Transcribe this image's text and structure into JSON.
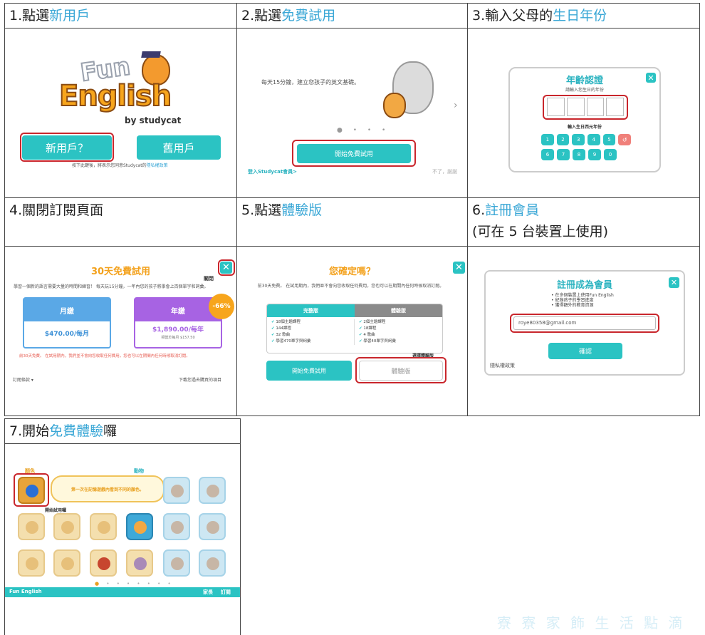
{
  "steps": [
    {
      "num": "1.",
      "pre": "點選",
      "hl": "新用戶",
      "post": "",
      "line2": ""
    },
    {
      "num": "2.",
      "pre": "點選",
      "hl": "免費試用",
      "post": "",
      "line2": ""
    },
    {
      "num": "3.",
      "pre": "輸入父母的",
      "hl": "生日年份",
      "post": "",
      "line2": ""
    },
    {
      "num": "4.",
      "pre": "關閉訂閱頁面",
      "hl": "",
      "post": "",
      "line2": ""
    },
    {
      "num": "5.",
      "pre": "點選",
      "hl": "體驗版",
      "post": "",
      "line2": ""
    },
    {
      "num": "6.",
      "pre": "",
      "hl": "註冊會員",
      "post": "",
      "line2": "(可在 5 台裝置上使用)"
    },
    {
      "num": "7.",
      "pre": "開始",
      "hl": "免費體驗",
      "post": "囉",
      "line2": ""
    }
  ],
  "s1": {
    "logo_fun": "Fun",
    "logo_english": "English",
    "logo_by": "by studycat",
    "new_user": "新用戶？",
    "old_user": "舊用戶",
    "consent": "按下此鍵後，將表示您同意Studycat的",
    "consent_link": "隱私權政策"
  },
  "s2": {
    "tagline": "每天15分鐘，建立您孩子的英文基礎。",
    "start_trial": "開始免費試用",
    "login": "登入Studycat會員>",
    "no_thanks": "不了，謝謝"
  },
  "s3": {
    "title": "年齡認證",
    "prompt": "請輸入您生日的年份",
    "hint": "輸入生日西元年份",
    "keys": [
      "1",
      "2",
      "3",
      "4",
      "5",
      "↺",
      "6",
      "7",
      "8",
      "9",
      "0"
    ]
  },
  "s4": {
    "title": "30天免費試用",
    "close_label": "關閉",
    "desc": "學習一個新的語言需要大量的時間和練習！ 每天玩15分鐘，一年內您的孩子將學會上百個單字和詞彙。",
    "monthly_label": "月繳",
    "monthly_price": "$470.00/每月",
    "yearly_label": "年繳",
    "yearly_price": "$1,890.00/每年",
    "yearly_sub": "相當於每月 $157.50",
    "badge": "-66%",
    "notice": "前30天免費。 在試用期內，我們並不會向您收取任何費用，您也可以在期間內任何時候取消訂閱。",
    "terms": "訂閱條款 ▾",
    "restore": "下載您過去購買的項目"
  },
  "s5": {
    "title": "您確定嗎？",
    "desc": "前30天免費。 在試用期內，我們並不會向您收取任何費用，您也可以在期間內任何時候取消訂閱。",
    "full_header": "完整版",
    "trial_header": "體驗版",
    "full_items": [
      "18個主題課程",
      "144課程",
      "32 歌曲",
      "學習470單字與詞彙"
    ],
    "trial_items": [
      "2個主題課程",
      "18課程",
      "4 歌曲",
      "學習40單字與詞彙"
    ],
    "choose_trial": "選擇體驗版",
    "start_trial": "開始免費試用",
    "trial_btn": "體驗版"
  },
  "s6": {
    "title": "註冊成為會員",
    "bullets": [
      "在多個裝置上使用Fun English",
      "紀錄孩子的學習進度",
      "獲得額外的教育資源"
    ],
    "email": "roye80358@gmail.com",
    "confirm": "確認",
    "privacy": "隱私權政策"
  },
  "s7": {
    "cat_colors": "顏色",
    "cat_animals": "動物",
    "tooltip": "第一次在記憶遊戲內看到不同的顏色。",
    "start_here": "開始試用囉",
    "app_name": "Fun English",
    "nav_parent": "家長",
    "nav_subscribe": "訂閱"
  },
  "watermark": "寮 寮 家 飾 生 活 點 滴"
}
